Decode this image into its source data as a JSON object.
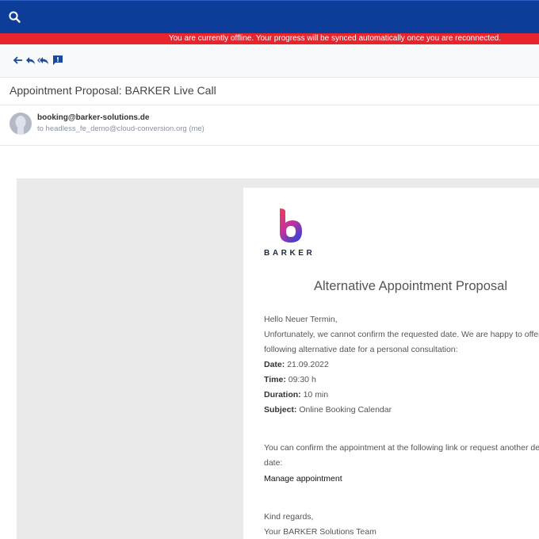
{
  "colors": {
    "topbar": "#0d3d99",
    "offline_banner": "#e8242c",
    "accent_icons": "#1a4a9e"
  },
  "header": {
    "search_icon": "search-icon"
  },
  "offline_banner": {
    "text": "You are currently offline. Your progress will be synced automatically once you are reconnected."
  },
  "toolbar": {
    "icons": [
      "back-arrow-icon",
      "reply-icon",
      "reply-all-icon",
      "report-icon"
    ]
  },
  "message": {
    "subject": "Appointment Proposal: BARKER Live Call",
    "from": "booking@barker-solutions.de",
    "to_line": "to headless_fe_demo@cloud-conversion.org (me)"
  },
  "email": {
    "brand": "BARKER",
    "title": "Alternative Appointment Proposal",
    "greeting": "Hello Neuer Termin,",
    "intro_1": "Unfortunately, we cannot confirm the requested date. We are happy to offer",
    "intro_2": "following alternative date for a personal consultation:",
    "date_label": "Date:",
    "date_value": "21.09.2022",
    "time_label": "Time:",
    "time_value": "09:30 h",
    "duration_label": "Duration:",
    "duration_value": "10 min",
    "subject_label": "Subject:",
    "subject_value": "Online Booking Calendar",
    "confirm_1": "You can confirm the appointment at the following link or request another des",
    "confirm_2": "date:",
    "manage_link": "Manage appointment",
    "regards": "Kind regards,",
    "signature": "Your BARKER Solutions Team"
  }
}
